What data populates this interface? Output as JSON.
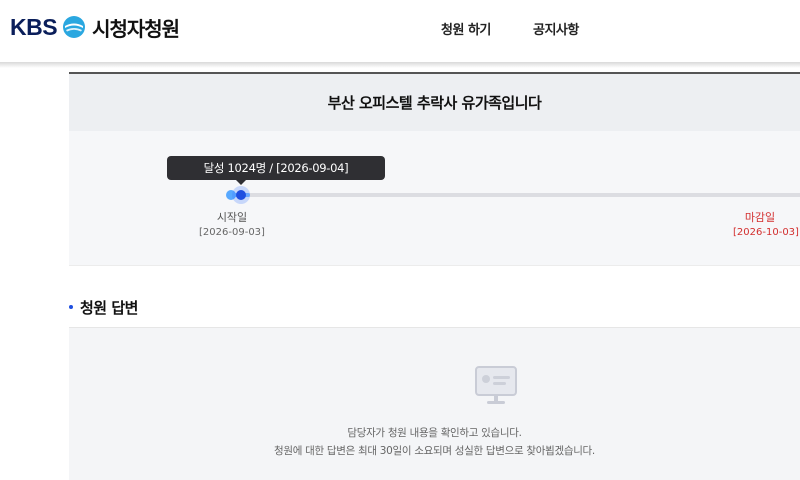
{
  "header": {
    "logo_text": "KBS",
    "site_name": "시청자청원",
    "nav": [
      "청원 하기",
      "공지사항"
    ]
  },
  "petition": {
    "title": "부산 오피스텔 추락사 유가족입니다",
    "tooltip": "달성 1024명 / [2026-09-04]",
    "start_label": "시작일",
    "start_date": "[2026-09-03]",
    "end_label": "마감일",
    "end_date": "[2026-10-03]",
    "progress_fraction": 0.03
  },
  "answer": {
    "section_title": "청원 답변",
    "line1": "담당자가 청원 내용을 확인하고 있습니다.",
    "line2": "청원에 대한 답변은 최대 30일이 소요되며 성실한 답변으로 찾아뵙겠습니다."
  },
  "colors": {
    "brand_navy": "#0a1e5a",
    "accent_blue": "#1f4fe0",
    "deadline_red": "#d32f2f"
  },
  "icons": {
    "logo_emblem": "kbs-emblem-icon",
    "answer_placeholder": "monitor-document-icon"
  }
}
